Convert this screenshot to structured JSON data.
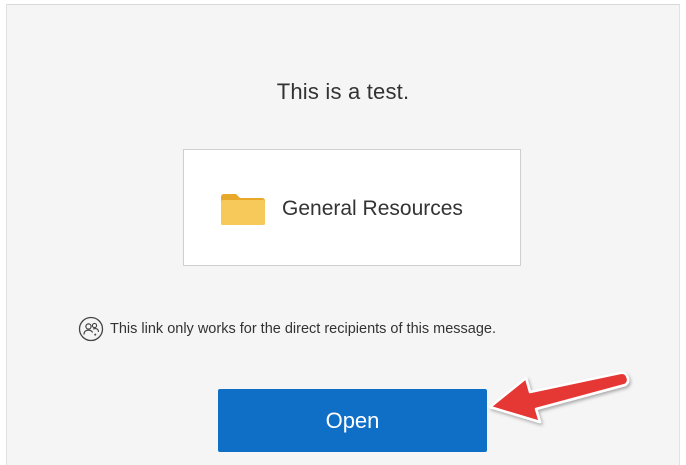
{
  "message": {
    "text": "This is a test."
  },
  "resource": {
    "name": "General Resources",
    "icon": "folder-icon",
    "folder_color": "#f7c343"
  },
  "notice": {
    "icon": "people-icon",
    "text": "This link only works for the direct recipients of this message."
  },
  "open_button": {
    "label": "Open",
    "color": "#0f6fc6"
  },
  "annotation": {
    "icon": "red-arrow-pointer",
    "color": "#e53935"
  }
}
